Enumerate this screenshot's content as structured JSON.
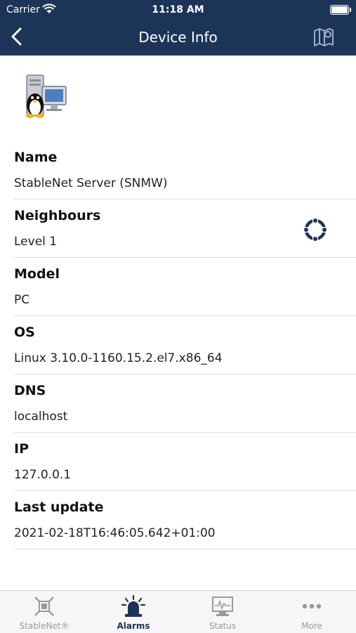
{
  "status_bar": {
    "carrier": "Carrier",
    "time": "11:18 AM"
  },
  "nav": {
    "title": "Device Info"
  },
  "fields": [
    {
      "label": "Name",
      "value": "StableNet Server (SNMW)"
    },
    {
      "label": "Neighbours",
      "value": "Level 1"
    },
    {
      "label": "Model",
      "value": "PC"
    },
    {
      "label": "OS",
      "value": "Linux 3.10.0-1160.15.2.el7.x86_64"
    },
    {
      "label": "DNS",
      "value": "localhost"
    },
    {
      "label": "IP",
      "value": "127.0.0.1"
    },
    {
      "label": "Last update",
      "value": "2021-02-18T16:46:05.642+01:00"
    }
  ],
  "tabs": [
    {
      "label": "StableNet®",
      "icon": "stablenet-icon"
    },
    {
      "label": "Alarms",
      "icon": "alarm-siren-icon",
      "active": true
    },
    {
      "label": "Status",
      "icon": "monitor-icon"
    },
    {
      "label": "More",
      "icon": "more-icon"
    }
  ],
  "colors": {
    "header": "#1c3458",
    "accent": "#1c3458",
    "inactive": "#9a9a9a"
  }
}
